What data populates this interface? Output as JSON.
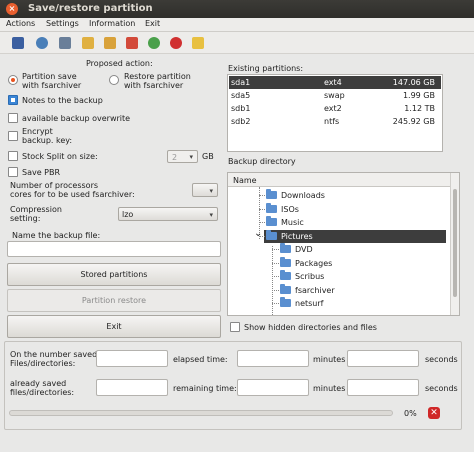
{
  "window": {
    "title": "Save/restore partition",
    "close_glyph": "×"
  },
  "menu": [
    "Actions",
    "Settings",
    "Information",
    "Exit"
  ],
  "toolbar_icons": [
    "save-icon",
    "restore-icon",
    "drive-icon",
    "folder-icon",
    "folder-open-icon",
    "folder-red-icon",
    "disk-icon",
    "stop-icon",
    "export-icon"
  ],
  "left": {
    "proposed_action": "Proposed action:",
    "radio_save": "Partition save\nwith fsarchiver",
    "radio_restore": "Restore partition\nwith fsarchiver",
    "notes": "Notes to  the backup",
    "available_overwrite": "available backup overwrite",
    "encrypt": "Encrypt\nbackup. key:",
    "stock_split": "Stock Split on size:",
    "split_value": "2",
    "split_unit": "GB",
    "save_pbr": "Save PBR",
    "num_processors": "Number of processors\ncores for to be used fsarchiver:",
    "compression": "Compression\nsetting:",
    "compression_value": "lzo",
    "backup_file_name": "Name the backup file:",
    "backup_file_value": "",
    "stored_partitions": "Stored partitions",
    "partition_restore": "Partition restore",
    "exit": "Exit"
  },
  "right": {
    "existing_partitions": "Existing partitions:",
    "partitions": [
      {
        "name": "sda1",
        "fs": "ext4",
        "size": "147.06 GB",
        "selected": true
      },
      {
        "name": "sda5",
        "fs": "swap",
        "size": "1.99 GB",
        "selected": false
      },
      {
        "name": "sdb1",
        "fs": "ext2",
        "size": "1.12 TB",
        "selected": false
      },
      {
        "name": "sdb2",
        "fs": "ntfs",
        "size": "245.92 GB",
        "selected": false
      }
    ],
    "backup_directory": "Backup directory",
    "tree_header": "Name",
    "tree": [
      {
        "label": "Downloads",
        "depth": 1,
        "expanded": false,
        "selected": false
      },
      {
        "label": "ISOs",
        "depth": 1,
        "expanded": false,
        "selected": false
      },
      {
        "label": "Music",
        "depth": 1,
        "expanded": false,
        "selected": false
      },
      {
        "label": "Pictures",
        "depth": 1,
        "expanded": true,
        "selected": true
      },
      {
        "label": "DVD",
        "depth": 2,
        "expanded": false,
        "selected": false
      },
      {
        "label": "Packages",
        "depth": 2,
        "expanded": false,
        "selected": false
      },
      {
        "label": "Scribus",
        "depth": 2,
        "expanded": false,
        "selected": false
      },
      {
        "label": "fsarchiver",
        "depth": 2,
        "expanded": false,
        "selected": false
      },
      {
        "label": "netsurf",
        "depth": 2,
        "expanded": false,
        "selected": false
      }
    ],
    "show_hidden": "Show hidden directories and files"
  },
  "status": {
    "saved_files": "On the number saved\nFiles/directories:",
    "already_saved": "already saved\nfiles/directories:",
    "elapsed": "elapsed time:",
    "remaining": "remaining time:",
    "minutes": "minutes",
    "seconds": "seconds",
    "progress_text": "0%",
    "progress": 0
  }
}
